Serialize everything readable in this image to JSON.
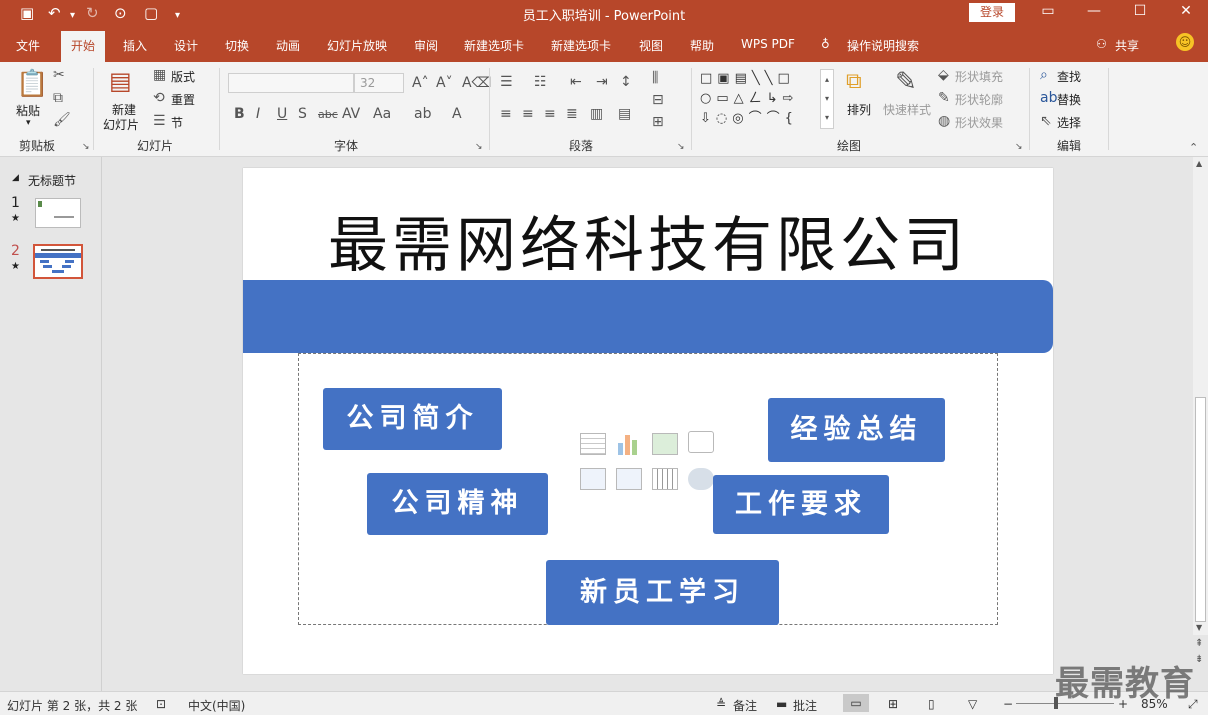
{
  "window": {
    "title": "员工入职培训 - PowerPoint",
    "login_label": "登录",
    "share_label": "共享",
    "minimize": "—",
    "restore": "☐",
    "close": "✕"
  },
  "tabs": [
    {
      "label": "文件"
    },
    {
      "label": "开始"
    },
    {
      "label": "插入"
    },
    {
      "label": "设计"
    },
    {
      "label": "切换"
    },
    {
      "label": "动画"
    },
    {
      "label": "幻灯片放映"
    },
    {
      "label": "审阅"
    },
    {
      "label": "新建选项卡"
    },
    {
      "label": "新建选项卡"
    },
    {
      "label": "视图"
    },
    {
      "label": "帮助"
    },
    {
      "label": "WPS PDF"
    },
    {
      "label": "操作说明搜索"
    }
  ],
  "ribbon": {
    "clipboard": {
      "paste": "粘贴",
      "group": "剪贴板"
    },
    "slides": {
      "new_slide_1": "新建",
      "new_slide_2": "幻灯片",
      "layout": "版式",
      "reset": "重置",
      "section": "节",
      "group": "幻灯片"
    },
    "font": {
      "size": "32",
      "group": "字体"
    },
    "paragraph": {
      "group": "段落"
    },
    "drawing": {
      "arrange": "排列",
      "quick_styles": "快速样式",
      "shape_fill": "形状填充",
      "shape_outline": "形状轮廓",
      "shape_effects": "形状效果",
      "group": "绘图"
    },
    "editing": {
      "find": "查找",
      "replace": "替换",
      "select": "选择",
      "group": "编辑"
    }
  },
  "thumbnails": {
    "section_title": "无标题节",
    "items": [
      {
        "number": "1"
      },
      {
        "number": "2"
      }
    ]
  },
  "slide": {
    "company_name": "最需网络科技有限公司",
    "nodes": [
      "公司简介",
      "经验总结",
      "公司精神",
      "工作要求",
      "新员工学习"
    ]
  },
  "status": {
    "slide_info": "幻灯片 第 2 张，共 2 张",
    "language": "中文(中国)",
    "notes": "备注",
    "comments": "批注",
    "zoom": "85%"
  },
  "watermark": "最需教育",
  "colors": {
    "accent": "#b7472a",
    "slide_blue": "#4472c4"
  }
}
